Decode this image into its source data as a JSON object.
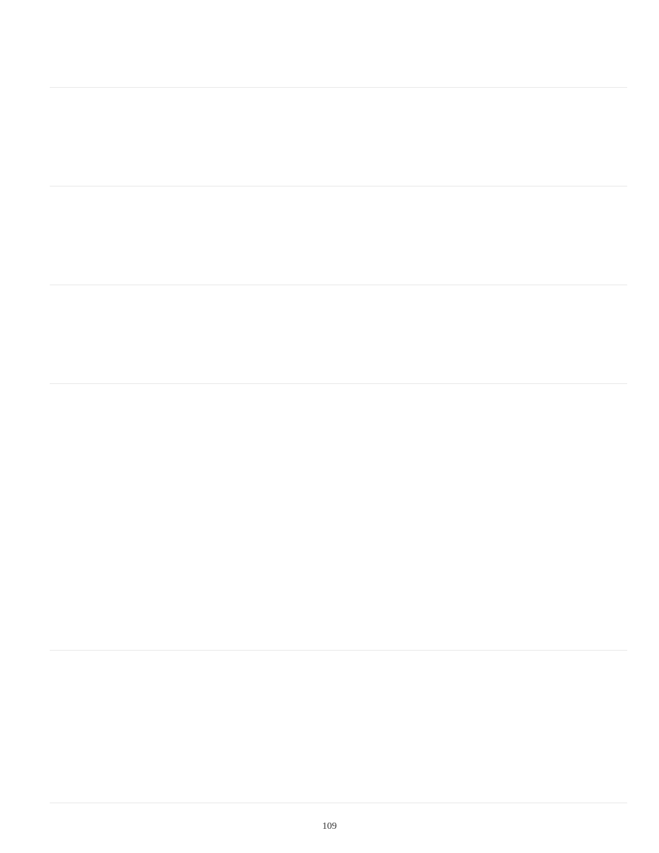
{
  "page_number": "109"
}
